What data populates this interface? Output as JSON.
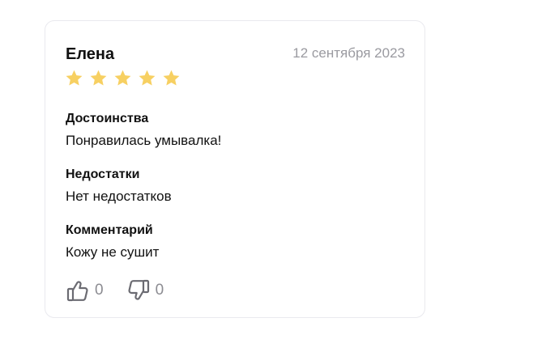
{
  "review": {
    "author": "Елена",
    "date": "12 сентября 2023",
    "rating": 5,
    "rating_max": 5,
    "star_color": "#f7d062",
    "sections": [
      {
        "title": "Достоинства",
        "text": "Понравилась умывалка!"
      },
      {
        "title": "Недостатки",
        "text": "Нет недостатков"
      },
      {
        "title": "Комментарий",
        "text": "Кожу не сушит"
      }
    ],
    "likes": "0",
    "dislikes": "0",
    "icons": {
      "like": "thumb-up-icon",
      "dislike": "thumb-down-icon",
      "star": "star-icon"
    }
  }
}
